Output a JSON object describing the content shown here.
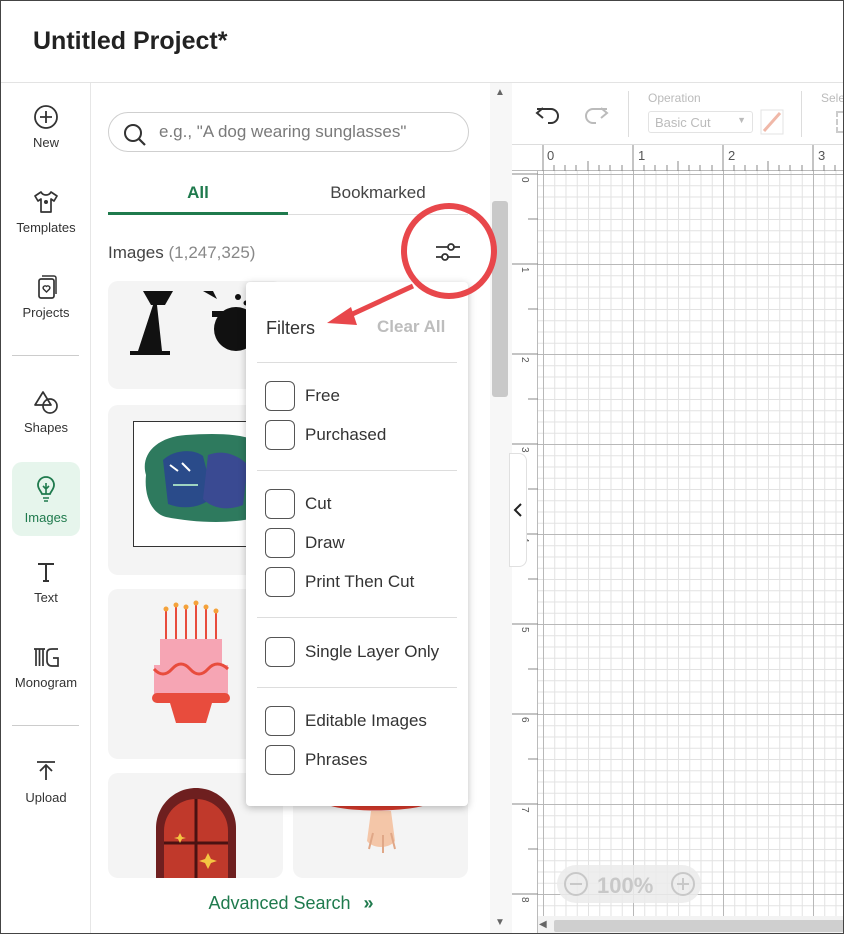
{
  "app": {
    "title": "Untitled Project*"
  },
  "nav": {
    "items": [
      {
        "label": "New",
        "icon": "plus-circle-icon"
      },
      {
        "label": "Templates",
        "icon": "tshirt-icon"
      },
      {
        "label": "Projects",
        "icon": "projects-icon"
      },
      {
        "label": "Shapes",
        "icon": "shapes-icon"
      },
      {
        "label": "Images",
        "icon": "lightbulb-icon"
      },
      {
        "label": "Text",
        "icon": "text-icon"
      },
      {
        "label": "Monogram",
        "icon": "monogram-icon"
      },
      {
        "label": "Upload",
        "icon": "upload-icon"
      }
    ]
  },
  "panel": {
    "search_placeholder": "e.g., \"A dog wearing sunglasses\"",
    "tabs": [
      {
        "label": "All",
        "active": true
      },
      {
        "label": "Bookmarked",
        "active": false
      }
    ],
    "images_label": "Images",
    "images_count": "(1,247,325)",
    "advanced_search": "Advanced Search",
    "advanced_search_arrow": "»"
  },
  "filters": {
    "title": "Filters",
    "clear_all": "Clear All",
    "options": [
      {
        "label": "Free",
        "checked": false
      },
      {
        "label": "Purchased",
        "checked": false
      },
      {
        "label": "Cut",
        "checked": false
      },
      {
        "label": "Draw",
        "checked": false
      },
      {
        "label": "Print Then Cut",
        "checked": false
      },
      {
        "label": "Single Layer Only",
        "checked": false
      },
      {
        "label": "Editable Images",
        "checked": false
      },
      {
        "label": "Phrases",
        "checked": false
      }
    ]
  },
  "toolbar": {
    "operation_label": "Operation",
    "operation_value": "Basic Cut",
    "select_label": "Sele"
  },
  "ruler": {
    "top": [
      "0",
      "1",
      "2",
      "3"
    ],
    "left": [
      "0",
      "1",
      "2",
      "3",
      "4",
      "5",
      "6",
      "7",
      "8"
    ]
  },
  "zoom": {
    "level": "100%",
    "minus": "−",
    "plus": "+"
  },
  "colors": {
    "accent": "#1f7a4d",
    "active_bg": "#e6f5ec",
    "annotation": "#e8474b"
  }
}
